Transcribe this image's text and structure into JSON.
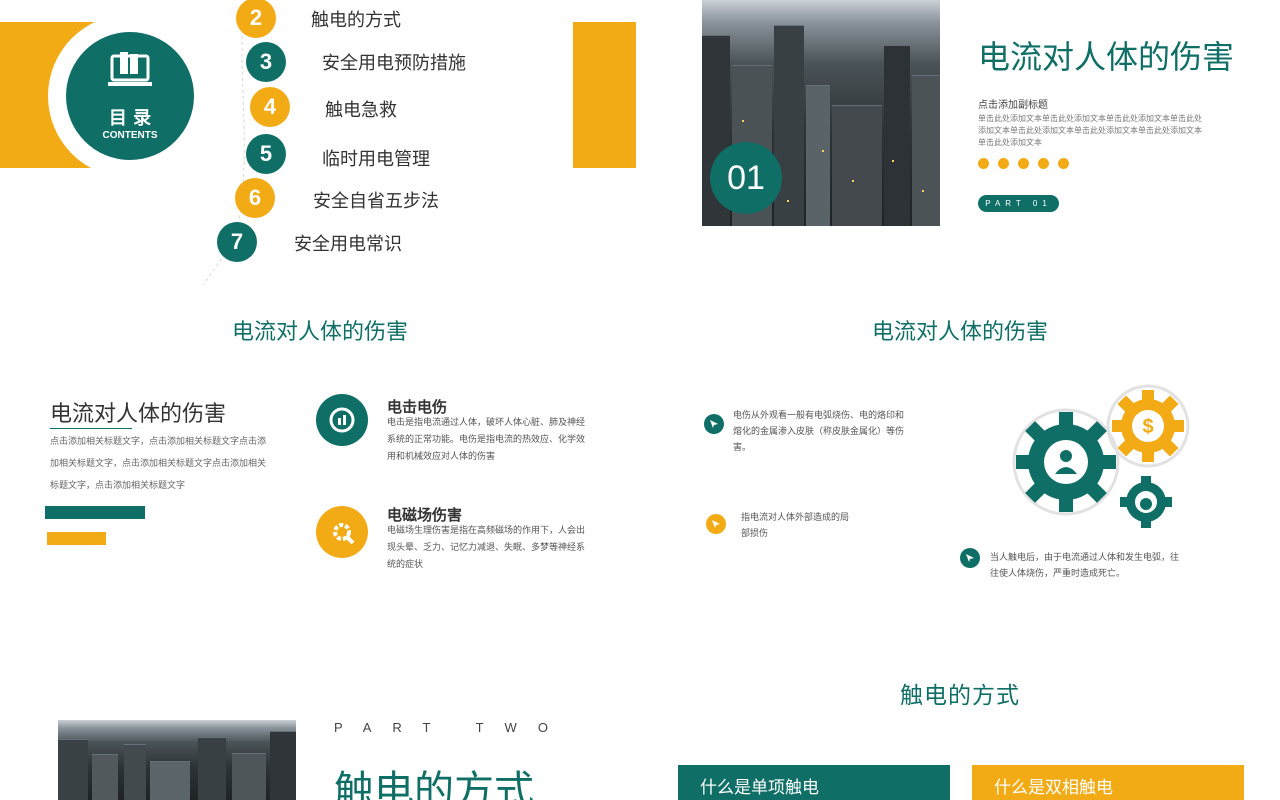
{
  "colors": {
    "teal": "#0f6f66",
    "yellow": "#f2ab15",
    "gray_text": "#666666"
  },
  "toc": {
    "title": "目 录",
    "subtitle": "CONTENTS",
    "items": [
      {
        "num": "2",
        "label": "触电的方式"
      },
      {
        "num": "3",
        "label": "安全用电预防措施"
      },
      {
        "num": "4",
        "label": "触电急救"
      },
      {
        "num": "5",
        "label": "临时用电管理"
      },
      {
        "num": "6",
        "label": "安全自省五步法"
      },
      {
        "num": "7",
        "label": "安全用电常识"
      }
    ]
  },
  "part_one": {
    "badge": "01",
    "title": "电流对人体的伤害",
    "subheading": "点击添加副标题",
    "body": "单击此处添加文本单击此处添加文本单击此处添加文本单击此处添加文本单击此处添加文本单击此处添加文本单击此处添加文本单击此处添加文本",
    "part_label": "PART 01"
  },
  "slide_hurt_a": {
    "heading": "电流对人体的伤害",
    "left_title": "电流对人体的伤害",
    "left_body": "点击添加相关标题文字，点击添加相关标题文字点击添加相关标题文字，点击添加相关标题文字点击添加相关标题文字，点击添加相关标题文字",
    "items": [
      {
        "title": "电击电伤",
        "body": "电击是指电流通过人体，破坏人体心脏、肺及神经系统的正常功能。电伤是指电流的热效应、化学效用和机械效应对人体的伤害",
        "icon": "chart-icon"
      },
      {
        "title": "电磁场伤害",
        "body": "电磁场生理伤害是指在高频磁场的作用下，人会出现头晕、乏力、记忆力减退、失眠、多梦等神经系统的症状",
        "icon": "gear-tool-icon"
      }
    ]
  },
  "slide_hurt_b": {
    "heading": "电流对人体的伤害",
    "notes": [
      "电伤从外观看一般有电弧烧伤、电的烙印和熔化的金属渗入皮肤（称皮肤金属化）等伤害。",
      "指电流对人体外部造成的局部损伤",
      "当人触电后，由于电流通过人体和发生电弧，往往使人体烧伤，严重时造成死亡。"
    ]
  },
  "part_two": {
    "part_label": "PART TWO",
    "title": "触电的方式"
  },
  "shock_slide": {
    "heading": "触电的方式",
    "cards": [
      {
        "title": "什么是单项触电"
      },
      {
        "title": "什么是双相触电"
      }
    ]
  }
}
